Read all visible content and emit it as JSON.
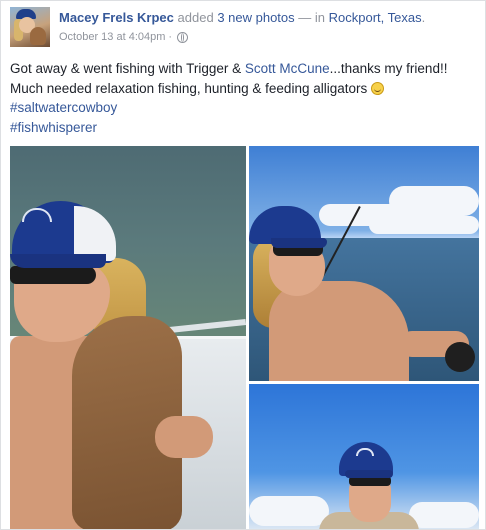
{
  "post": {
    "author_name": "Macey Frels Krpec",
    "action_text": "added",
    "photo_count_link": "3 new photos",
    "location_prefix": "— in",
    "location_link": "Rockport, Texas",
    "location_suffix": ".",
    "timestamp": "October 13 at 4:04pm",
    "separator": "·",
    "privacy_icon": "globe-icon",
    "body": {
      "line1_start": "Got away & went fishing with Trigger & ",
      "mention": "Scott McCune",
      "line1_end": "...thanks my friend!!",
      "line2": "Much needed relaxation fishing, hunting & feeding alligators ",
      "emoji": "smile-emoji",
      "hashtags": [
        "#saltwatercowboy",
        "#fishwhisperer"
      ]
    },
    "photos": [
      {
        "name": "photo-woman-with-dog-on-boat"
      },
      {
        "name": "photo-woman-fishing-on-water"
      },
      {
        "name": "photo-woman-holding-fish"
      }
    ]
  },
  "colors": {
    "link": "#365899",
    "meta": "#90949c",
    "text": "#1d2129",
    "hat_blue": "#1c3a8f"
  }
}
